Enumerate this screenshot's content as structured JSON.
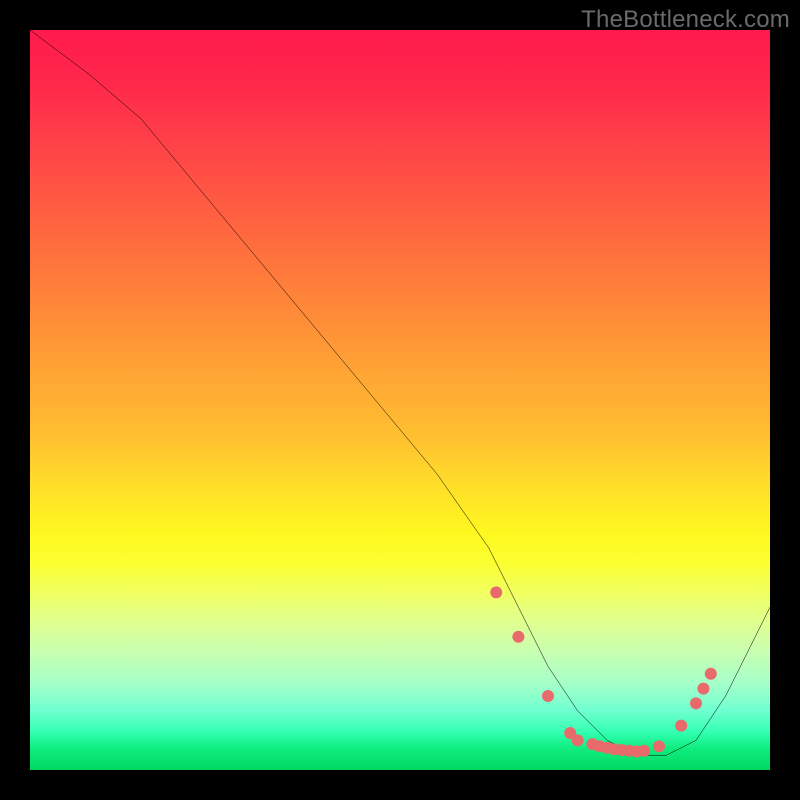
{
  "watermark": "TheBottleneck.com",
  "chart_data": {
    "type": "line",
    "title": "",
    "xlabel": "",
    "ylabel": "",
    "xlim": [
      0,
      100
    ],
    "ylim": [
      0,
      100
    ],
    "grid": false,
    "series": [
      {
        "name": "bottleneck-curve",
        "color": "#000000",
        "x": [
          0,
          4,
          8,
          15,
          25,
          35,
          45,
          55,
          62,
          66,
          70,
          74,
          78,
          82,
          86,
          90,
          94,
          100
        ],
        "y": [
          100,
          97,
          94,
          88,
          76,
          64,
          52,
          40,
          30,
          22,
          14,
          8,
          4,
          2,
          2,
          4,
          10,
          22
        ]
      }
    ],
    "markers": {
      "name": "highlight-points",
      "color": "#e96a6a",
      "radius": 6,
      "x": [
        63,
        66,
        70,
        73,
        74,
        76,
        77,
        78,
        79,
        80,
        81,
        82,
        83,
        85,
        88,
        90,
        91,
        92
      ],
      "y": [
        24,
        18,
        10,
        5,
        4,
        3.5,
        3.2,
        3,
        2.8,
        2.7,
        2.6,
        2.5,
        2.6,
        3.2,
        6,
        9,
        11,
        13
      ]
    },
    "background_gradient": {
      "stops": [
        {
          "pos": 0.0,
          "color": "#ff1a4d"
        },
        {
          "pos": 0.08,
          "color": "#ff2a4a"
        },
        {
          "pos": 0.15,
          "color": "#ff4048"
        },
        {
          "pos": 0.25,
          "color": "#ff6040"
        },
        {
          "pos": 0.35,
          "color": "#ff803a"
        },
        {
          "pos": 0.45,
          "color": "#ffa035"
        },
        {
          "pos": 0.55,
          "color": "#ffc030"
        },
        {
          "pos": 0.62,
          "color": "#ffe028"
        },
        {
          "pos": 0.68,
          "color": "#fff820"
        },
        {
          "pos": 0.72,
          "color": "#fbff30"
        },
        {
          "pos": 0.76,
          "color": "#f0ff60"
        },
        {
          "pos": 0.8,
          "color": "#e0ff90"
        },
        {
          "pos": 0.84,
          "color": "#c8ffb0"
        },
        {
          "pos": 0.88,
          "color": "#a8ffc8"
        },
        {
          "pos": 0.92,
          "color": "#70ffd0"
        },
        {
          "pos": 0.95,
          "color": "#30ffb0"
        },
        {
          "pos": 0.97,
          "color": "#10ee80"
        },
        {
          "pos": 1.0,
          "color": "#00d860"
        }
      ]
    }
  }
}
